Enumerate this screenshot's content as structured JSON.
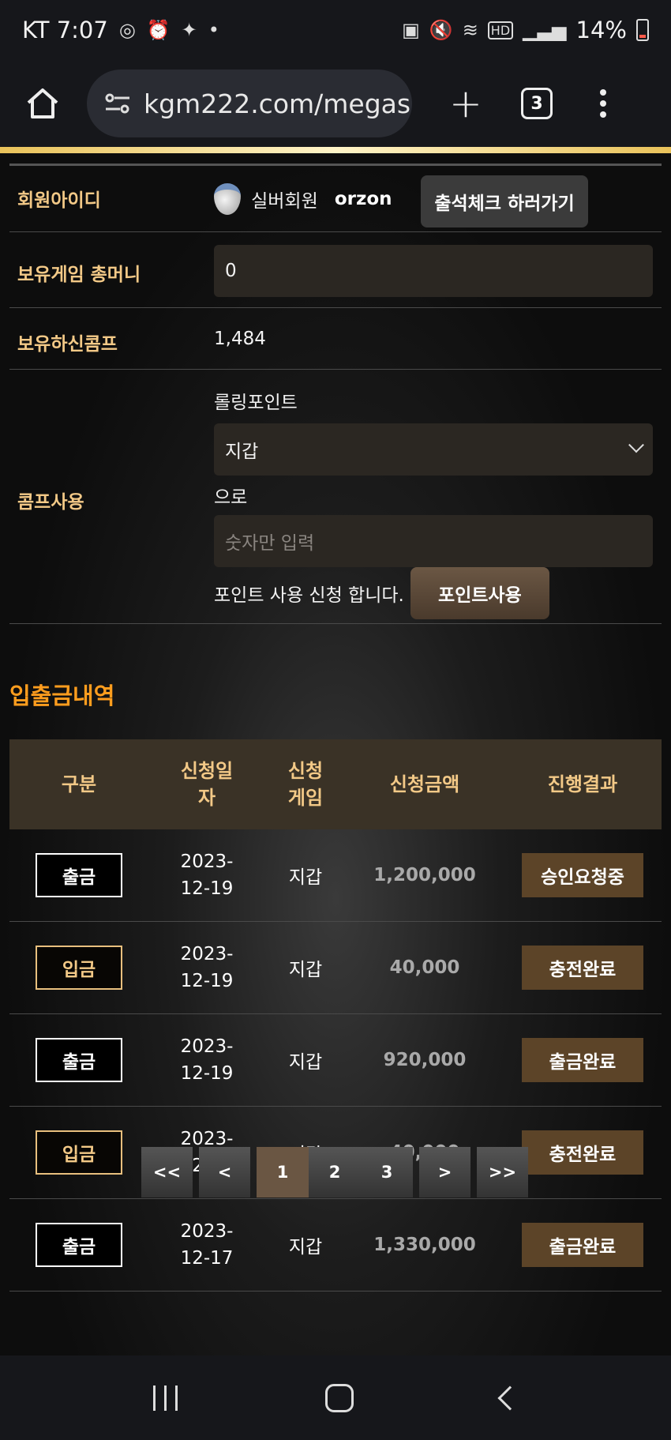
{
  "status_bar": {
    "carrier_time": "KT 7:07",
    "battery": "14%",
    "icons": [
      "instagram-icon",
      "alarm-icon",
      "sparkle-icon",
      "dot-icon",
      "battery-saver-icon",
      "mute-icon",
      "wifi-icon",
      "hd-icon",
      "signal-icon",
      "battery-icon"
    ]
  },
  "browser": {
    "url": "kgm222.com/megas",
    "tab_count": "3"
  },
  "profile": {
    "id_label": "회원아이디",
    "grade": "실버회원",
    "user_id": "orzon",
    "attendance_button": "출석체크 하러가기",
    "money_label": "보유게임 총머니",
    "money_value": "0",
    "comp_label": "보유하신콤프",
    "comp_value": "1,484",
    "use_label": "콤프사용",
    "rolling_label": "롤링포인트",
    "target_select": "지갑",
    "to_text": "으로",
    "amount_placeholder": "숫자만 입력",
    "request_text": "포인트 사용 신청 합니다.",
    "use_button": "포인트사용"
  },
  "history": {
    "title": "입출금내역",
    "headers": [
      "구분",
      "신청일\n자",
      "신청\n게임",
      "신청금액",
      "진행결과"
    ],
    "rows": [
      {
        "type": "출금",
        "date": "2023-\n12-19",
        "game": "지갑",
        "amount": "1,200,000",
        "status": "승인요청중"
      },
      {
        "type": "입금",
        "date": "2023-\n12-19",
        "game": "지갑",
        "amount": "40,000",
        "status": "충전완료"
      },
      {
        "type": "출금",
        "date": "2023-\n12-19",
        "game": "지갑",
        "amount": "920,000",
        "status": "출금완료"
      },
      {
        "type": "입금",
        "date": "2023-\n12-19",
        "game": "지갑",
        "amount": "40,000",
        "status": "충전완료"
      },
      {
        "type": "출금",
        "date": "2023-\n12-17",
        "game": "지갑",
        "amount": "1,330,000",
        "status": "출금완료"
      }
    ]
  },
  "pagination": {
    "first": "<<",
    "prev": "<",
    "pages": [
      "1",
      "2",
      "3"
    ],
    "current": "1",
    "next": ">",
    "last": ">>"
  },
  "colors": {
    "label_gold": "#f3c987",
    "section_orange": "#ff9d1e",
    "status_brown": "#5c4428"
  }
}
